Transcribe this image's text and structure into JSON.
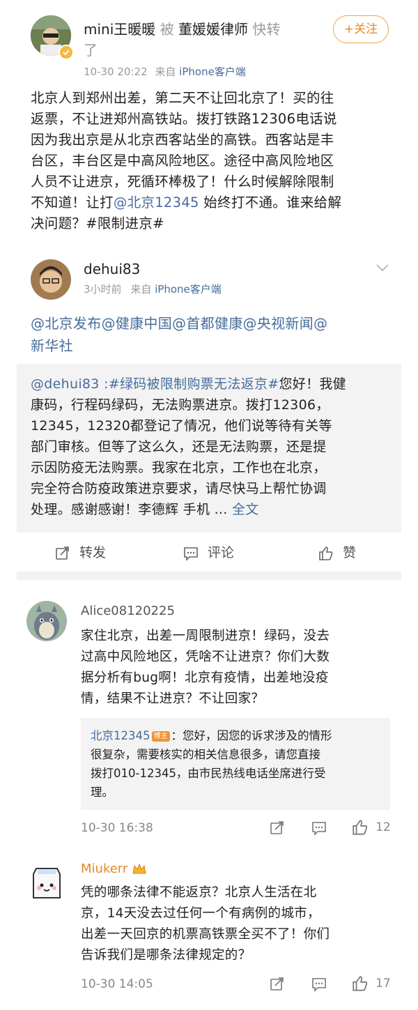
{
  "post1": {
    "user": "mini王暖暖",
    "repost_by": "被",
    "repost_target": "董媛媛律师",
    "repost_suffix": "快转",
    "repost_suffix2": "了",
    "follow_label": "+关注",
    "time": "10-30 20:22",
    "source_prefix": "来自",
    "source": "iPhone客户端",
    "body_lines": [
      "北京人到郑州出差，第二天不让回北京了！买的往",
      "返票，不让进郑州高铁站。拨打铁路12306电话说",
      "因为我出京是从北京西客站坐的高铁。西客站是丰",
      "台区，丰台区是中高风险地区。途径中高风险地区",
      "人员不让进京，死循环棒极了！什么时候解除限制"
    ],
    "line6_pre": "不知道！让打",
    "line6_mention": "@北京12345",
    "line6_post": " 始终打不通。谁来给解",
    "line7": "决问题？#限制进京#"
  },
  "post2": {
    "user": "dehui83",
    "time": "3小时前",
    "source_prefix": "来自",
    "source": "iPhone客户端",
    "mentions_line1": "@北京发布@健康中国@首都健康@央视新闻@",
    "mentions_line2": "新华社",
    "quote_line1_mention": "@dehui83 :#绿码被限制购票无法返京#",
    "quote_line1_rest": "您好！我健",
    "quote_lines": [
      "康码，行程码绿码，无法购票进京。拨打12306，",
      "12345，12320都登记了情况，他们说等待有关等",
      "部门审核。但等了这么久，还是无法购票，还是提",
      "示因防疫无法购票。我家在北京，工作也在北京，",
      "完全符合防疫政策进京要求，请尽快马上帮忙协调"
    ],
    "quote_last_pre": "处理。感谢感谢！李德辉 手机 ... ",
    "quote_last_link": "全文",
    "actions": {
      "repost": "转发",
      "comment": "评论",
      "like": "赞"
    }
  },
  "comment1": {
    "user": "Alice08120225",
    "lines": [
      "家住北京，出差一周限制进京！绿码，没去",
      "过高中风险地区，凭啥不让进京？你们大数",
      "据分析有bug啊！北京有疫情，出差地没疫",
      "情，结果不让进京？不让回家？"
    ],
    "reply_user": "北京12345",
    "reply_badge": "博主",
    "reply_line1": "：您好，因您的诉求涉及的情形",
    "reply_lines": [
      "很复杂，需要核实的相关信息很多，请您直接",
      "拨打010-12345，由市民热线电话坐席进行受",
      "理。"
    ],
    "time": "10-30 16:38",
    "likes": "12"
  },
  "comment2": {
    "user": "Miukerr",
    "lines": [
      "凭的哪条法律不能返京？北京人生活在北",
      "京，14天没去过任何一个有病例的城市，",
      "出差一天回京的机票高铁票全买不了！你们",
      "告诉我们是哪条法律规定的？"
    ],
    "time": "10-30 14:05",
    "likes": "17"
  },
  "colors": {
    "link": "#476c9c",
    "accent": "#e58a25"
  },
  "icons": [
    "verified-badge-icon",
    "chevron-down-icon",
    "repost-icon",
    "comment-icon",
    "like-icon",
    "share-icon",
    "vip-crown-icon"
  ]
}
